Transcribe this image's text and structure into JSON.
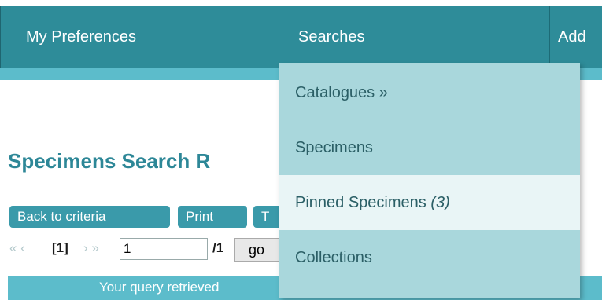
{
  "nav": {
    "items": [
      {
        "label": "My Preferences"
      },
      {
        "label": "Searches"
      },
      {
        "label": "Add"
      }
    ]
  },
  "page": {
    "title": "Specimens Search R"
  },
  "buttons": {
    "back_to_criteria": "Back to criteria",
    "print": "Print",
    "third": "T"
  },
  "pager": {
    "first_prev": "« ‹",
    "current": "[1]",
    "next_last": "› »",
    "page_input_value": "1",
    "total": "/1",
    "go_label": "go"
  },
  "result_bar": {
    "text": "Your query retrieved"
  },
  "dropdown": {
    "items": [
      {
        "label": "Catalogues »",
        "count": ""
      },
      {
        "label": "Specimens",
        "count": ""
      },
      {
        "label": "Pinned Specimens ",
        "count": "(3)"
      },
      {
        "label": "Collections",
        "count": ""
      }
    ]
  },
  "colors": {
    "nav_bg": "#2e8c99",
    "subbar_bg": "#5cbccb",
    "dropdown_bg": "#a9d7dc",
    "dropdown_hover": "#e9f5f6",
    "title_color": "#2d8797",
    "button_bg": "#3a9aaa"
  }
}
